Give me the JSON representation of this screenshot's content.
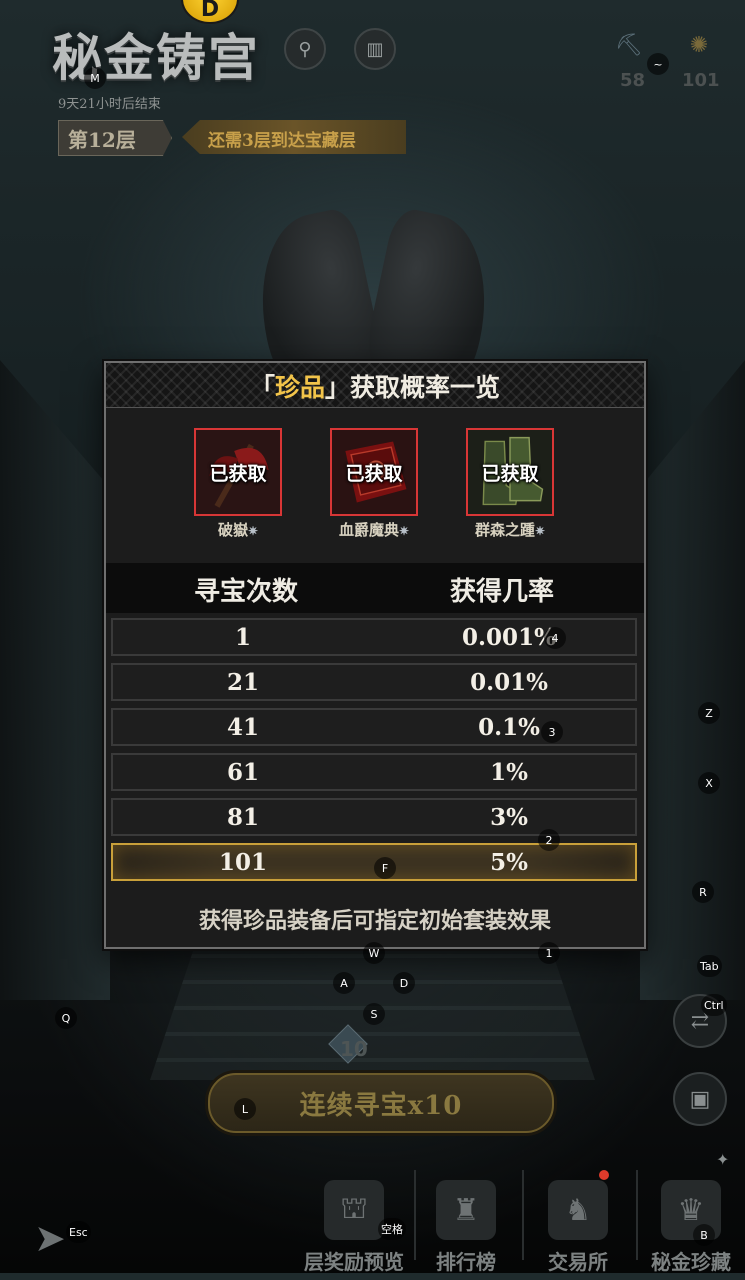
{
  "header": {
    "title": "秘金铸宫",
    "subtitle": "9天21小时后结束",
    "floor": "第12层",
    "hint": "还需3层到达宝藏层",
    "coin_label": "D",
    "resources": [
      {
        "icon": "pickaxe-icon",
        "value": "58"
      },
      {
        "icon": "compass-icon",
        "value": "101"
      }
    ]
  },
  "panel": {
    "title_prefix": "「",
    "title_highlight": "珍品",
    "title_suffix": "」获取概率一览",
    "items": [
      {
        "name": "破嶽",
        "status": "已获取",
        "star": "✷",
        "color": "#d83636"
      },
      {
        "name": "血爵魔典",
        "status": "已获取",
        "star": "✷",
        "color": "#d83636"
      },
      {
        "name": "群森之踵",
        "status": "已获取",
        "star": "✷",
        "color": "#d83636"
      }
    ],
    "table": {
      "headers": [
        "寻宝次数",
        "获得几率"
      ],
      "rows": [
        {
          "count": "1",
          "rate": "0.001%"
        },
        {
          "count": "21",
          "rate": "0.01%"
        },
        {
          "count": "41",
          "rate": "0.1%"
        },
        {
          "count": "61",
          "rate": "1%"
        },
        {
          "count": "81",
          "rate": "3%"
        },
        {
          "count": "101",
          "rate": "5%"
        }
      ],
      "highlighted_row": 5
    },
    "footnote": "获得珍品装备后可指定初始套装效果"
  },
  "actions": {
    "count_label": "10",
    "search_button": "连续寻宝x10"
  },
  "bottom_nav": [
    {
      "label": "层奖励预览",
      "icon": "treasure-chest-icon"
    },
    {
      "label": "排行榜",
      "icon": "trophy-icon"
    },
    {
      "label": "交易所",
      "icon": "merchant-icon"
    },
    {
      "label": "秘金珍藏",
      "icon": "collection-icon"
    }
  ],
  "key_hints": {
    "m": "M",
    "tilde": "~",
    "four": "4",
    "three": "3",
    "two": "2",
    "one": "1",
    "z": "Z",
    "x": "X",
    "r": "R",
    "tab": "Tab",
    "ctrl": "Ctrl",
    "f": "F",
    "w": "W",
    "a": "A",
    "s": "S",
    "d": "D",
    "q": "Q",
    "l": "L",
    "esc": "Esc",
    "space": "空格",
    "b": "B"
  },
  "colors": {
    "highlight_gold": "#f2c44a",
    "acquired_border": "#d83636",
    "row_highlight": "#c9a03a"
  }
}
